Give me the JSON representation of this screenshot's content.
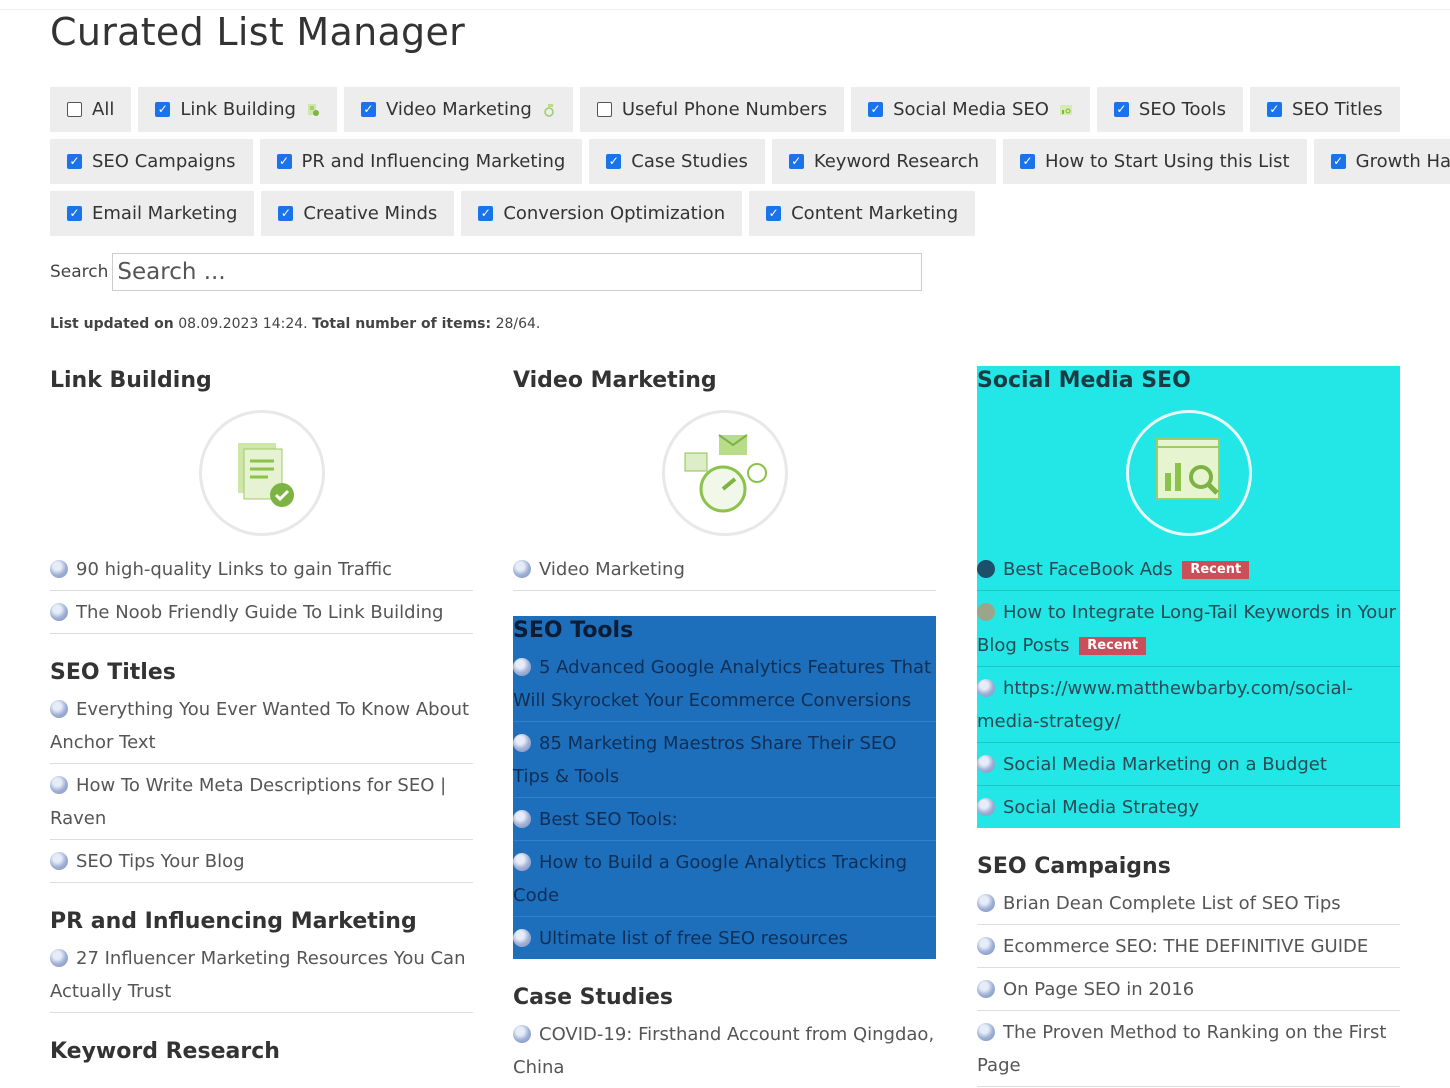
{
  "page": {
    "title": "Curated List Manager"
  },
  "filters": [
    [
      {
        "label": "All",
        "checked": false
      },
      {
        "label": "Link Building",
        "checked": true,
        "icon": "document-check-icon"
      },
      {
        "label": "Video Marketing",
        "checked": true,
        "icon": "gauge-icon"
      },
      {
        "label": "Useful Phone Numbers",
        "checked": false
      },
      {
        "label": "Social Media SEO",
        "checked": true,
        "icon": "chart-search-icon"
      },
      {
        "label": "SEO Tools",
        "checked": true
      },
      {
        "label": "SEO Titles",
        "checked": true
      }
    ],
    [
      {
        "label": "SEO Campaigns",
        "checked": true
      },
      {
        "label": "PR and Influencing Marketing",
        "checked": true
      },
      {
        "label": "Case Studies",
        "checked": true
      },
      {
        "label": "Keyword Research",
        "checked": true
      },
      {
        "label": "How to Start Using this List",
        "checked": true
      },
      {
        "label": "Growth Hacking",
        "checked": true
      }
    ],
    [
      {
        "label": "Email Marketing",
        "checked": true
      },
      {
        "label": "Creative Minds",
        "checked": true
      },
      {
        "label": "Conversion Optimization",
        "checked": true
      },
      {
        "label": "Content Marketing",
        "checked": true
      }
    ]
  ],
  "search": {
    "label": "Search",
    "placeholder": "Search ..."
  },
  "status": {
    "updated_label": "List updated on",
    "updated_value": "08.09.2023 14:24",
    "total_label": "Total number of items:",
    "total_value": "28/64"
  },
  "sections": {
    "link_building": {
      "title": "Link Building",
      "items": [
        "90 high-quality Links to gain Traffic",
        "The Noob Friendly Guide To Link Building"
      ]
    },
    "seo_titles": {
      "title": "SEO Titles",
      "items": [
        "Everything You Ever Wanted To Know About Anchor Text",
        "How To Write Meta Descriptions for SEO | Raven",
        "SEO Tips Your Blog"
      ]
    },
    "pr": {
      "title": "PR and Influencing Marketing",
      "items": [
        "27 Influencer Marketing Resources You Can Actually Trust"
      ]
    },
    "keyword": {
      "title": "Keyword Research"
    },
    "video": {
      "title": "Video Marketing",
      "items": [
        "Video Marketing"
      ]
    },
    "seo_tools": {
      "title": "SEO Tools",
      "items": [
        "5 Advanced Google Analytics Features That Will Skyrocket Your Ecommerce Conversions",
        "85 Marketing Maestros Share Their SEO Tips & Tools",
        "Best SEO Tools:",
        "How to Build a Google Analytics Tracking Code",
        "Ultimate list of free SEO resources"
      ]
    },
    "case_studies": {
      "title": "Case Studies",
      "items": [
        "COVID-19: Firsthand Account from Qingdao, China"
      ]
    },
    "social": {
      "title": "Social Media SEO",
      "items": [
        {
          "text": "Best FaceBook Ads",
          "badge": "Recent"
        },
        {
          "text": "How to Integrate Long-Tail Keywords in Your Blog Posts",
          "badge": "Recent"
        },
        {
          "text": "https://www.matthewbarby.com/social-media-strategy/"
        },
        {
          "text": "Social Media Marketing on a Budget"
        },
        {
          "text": "Social Media Strategy"
        }
      ]
    },
    "campaigns": {
      "title": "SEO Campaigns",
      "items": [
        "Brian Dean Complete List of SEO Tips",
        "Ecommerce SEO: THE DEFINITIVE GUIDE",
        "On Page SEO in 2016",
        "The Proven Method to Ranking on the First Page"
      ]
    }
  }
}
